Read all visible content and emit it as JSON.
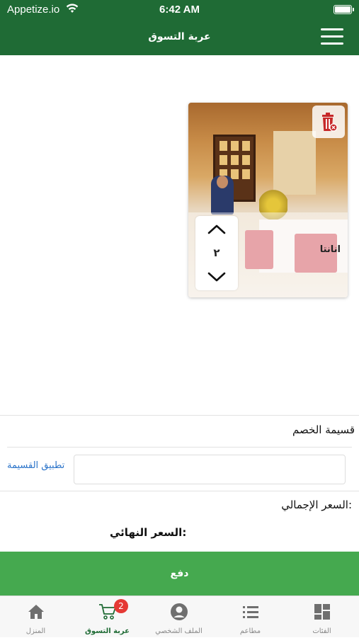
{
  "status_bar": {
    "carrier": "Appetize.io",
    "time": "6:42 AM"
  },
  "header": {
    "title": "عربة التسوق"
  },
  "cart_item": {
    "name": "انانتا",
    "quantity": "٢"
  },
  "coupon": {
    "label": "قسيمة الخصم",
    "placeholder": "",
    "apply_label": "تطبيق القسيمة"
  },
  "totals": {
    "total_label": "السعر الإجمالي:",
    "final_label": "السعر النهائي:"
  },
  "pay_button": {
    "label": "دفع"
  },
  "tabbar": {
    "cart_badge": "2",
    "tabs": [
      {
        "label": "المنزل",
        "icon": "home-icon"
      },
      {
        "label": "عربة التسوق",
        "icon": "cart-icon"
      },
      {
        "label": "الملف الشخصي",
        "icon": "profile-icon"
      },
      {
        "label": "مطاعم",
        "icon": "list-icon"
      },
      {
        "label": "الفئات",
        "icon": "grid-icon"
      }
    ]
  },
  "colors": {
    "primary": "#1f6b35",
    "pay": "#45a94f",
    "link": "#2a73c9",
    "badge": "#e53935",
    "delete": "#c62828"
  }
}
